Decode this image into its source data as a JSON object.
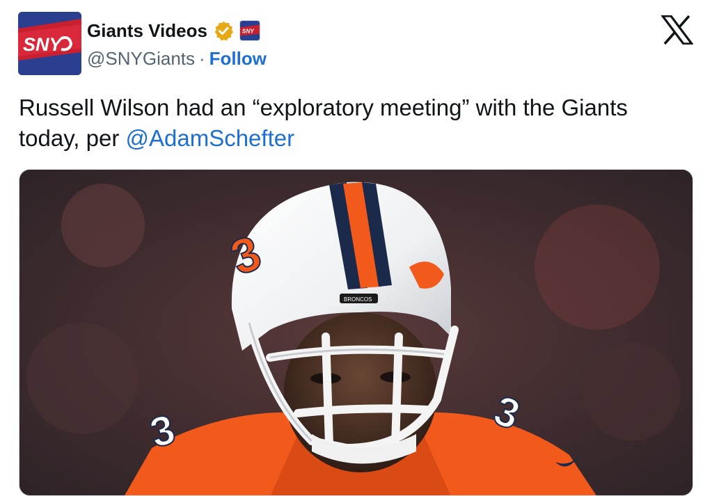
{
  "author": {
    "display_name": "Giants Videos",
    "handle": "@SNYGiants",
    "separator": "·",
    "follow_label": "Follow",
    "verified_icon": "verified-badge-icon",
    "avatar_text": "SNY",
    "affiliate_text": "SNY"
  },
  "tweet": {
    "text_before": "Russell Wilson had an “exploratory meeting” with the Giants today, per ",
    "mention": "@AdamSchefter"
  },
  "media": {
    "helmet_text": "BRONCOS",
    "jersey_number": "3"
  },
  "colors": {
    "follow": "#1d6fd1",
    "verified": "#e8a917",
    "brand_blue": "#2a3f8f",
    "brand_red": "#c8202e",
    "orange": "#f25a1c"
  },
  "close_icon": "x-logo-icon"
}
